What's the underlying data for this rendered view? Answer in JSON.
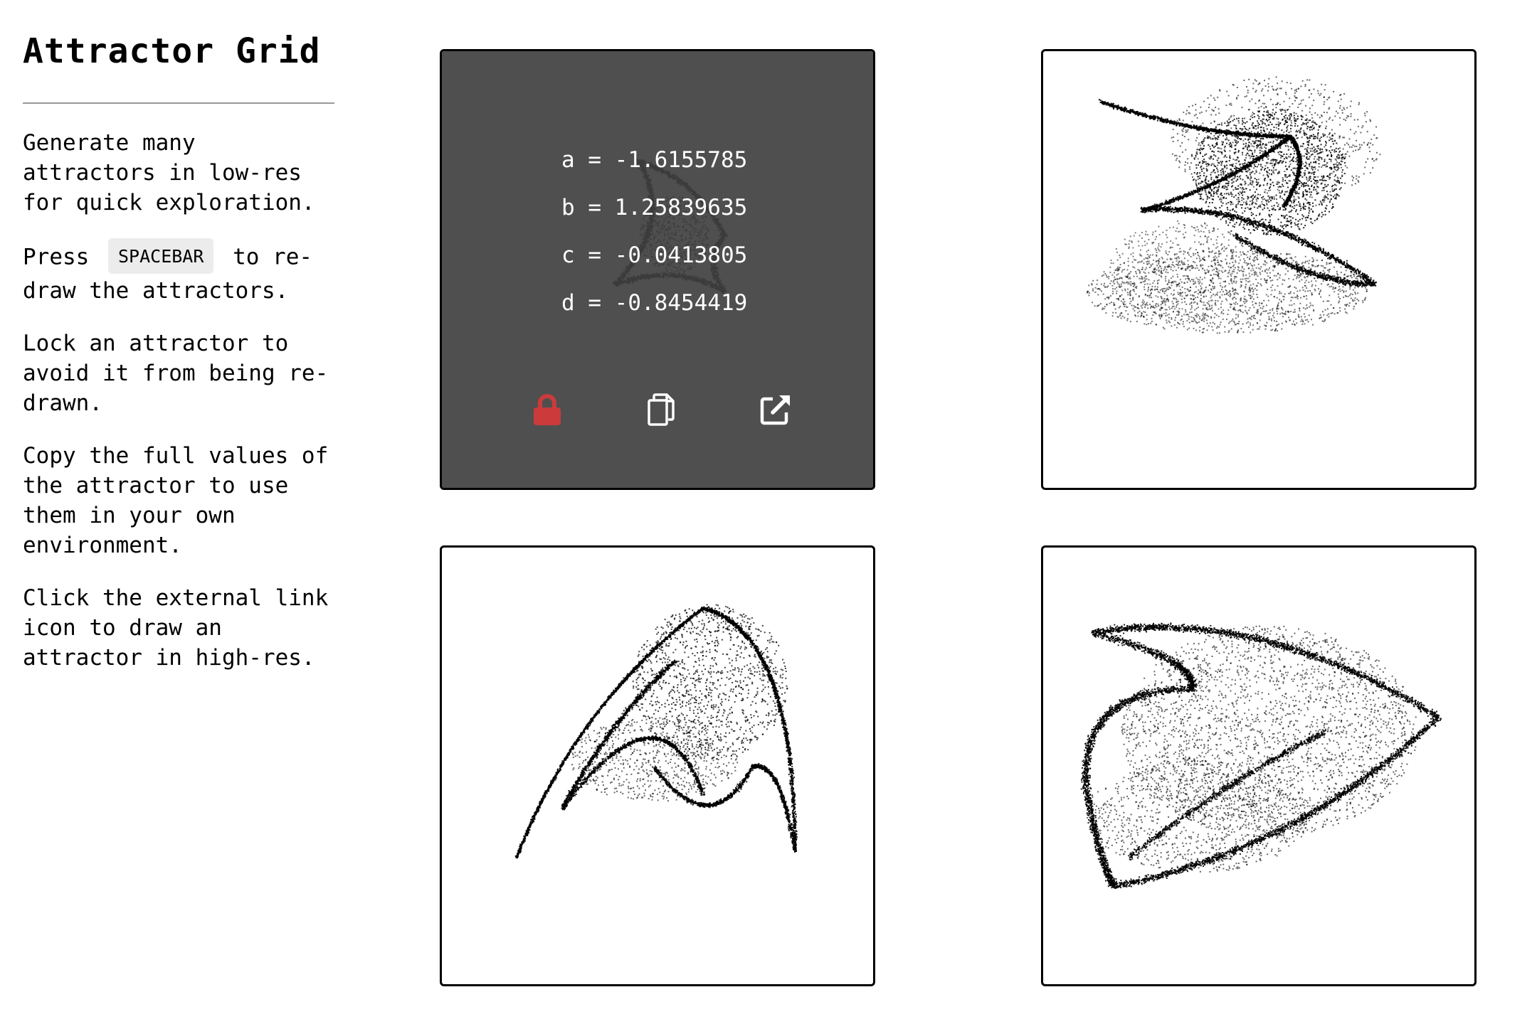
{
  "sidebar": {
    "title": "Attractor Grid",
    "paragraphs": {
      "p1": "Generate many attractors in low-res for quick exploration.",
      "p2_before": "Press",
      "p2_key": "SPACEBAR",
      "p2_after": "to re-draw the attractors.",
      "p3": "Lock an attractor to avoid it from being re-drawn.",
      "p4": "Copy the full values of the attractor to use them in your own environment.",
      "p5": "Click the external link icon to draw an attractor in high-res."
    }
  },
  "grid": {
    "cells": [
      {
        "hovered": true,
        "params": {
          "a": "a = -1.6155785",
          "b": "b = 1.25839635",
          "c": "c = -0.0413805",
          "d": "d = -0.8454419"
        },
        "locked": true
      },
      {
        "hovered": false
      },
      {
        "hovered": false
      },
      {
        "hovered": false
      }
    ],
    "icons": {
      "lock": "lock-icon",
      "copy": "copy-icon",
      "external": "external-link-icon"
    },
    "colors": {
      "lock_active": "#cc3b3b",
      "overlay": "#404040",
      "dots": "#000000"
    }
  }
}
